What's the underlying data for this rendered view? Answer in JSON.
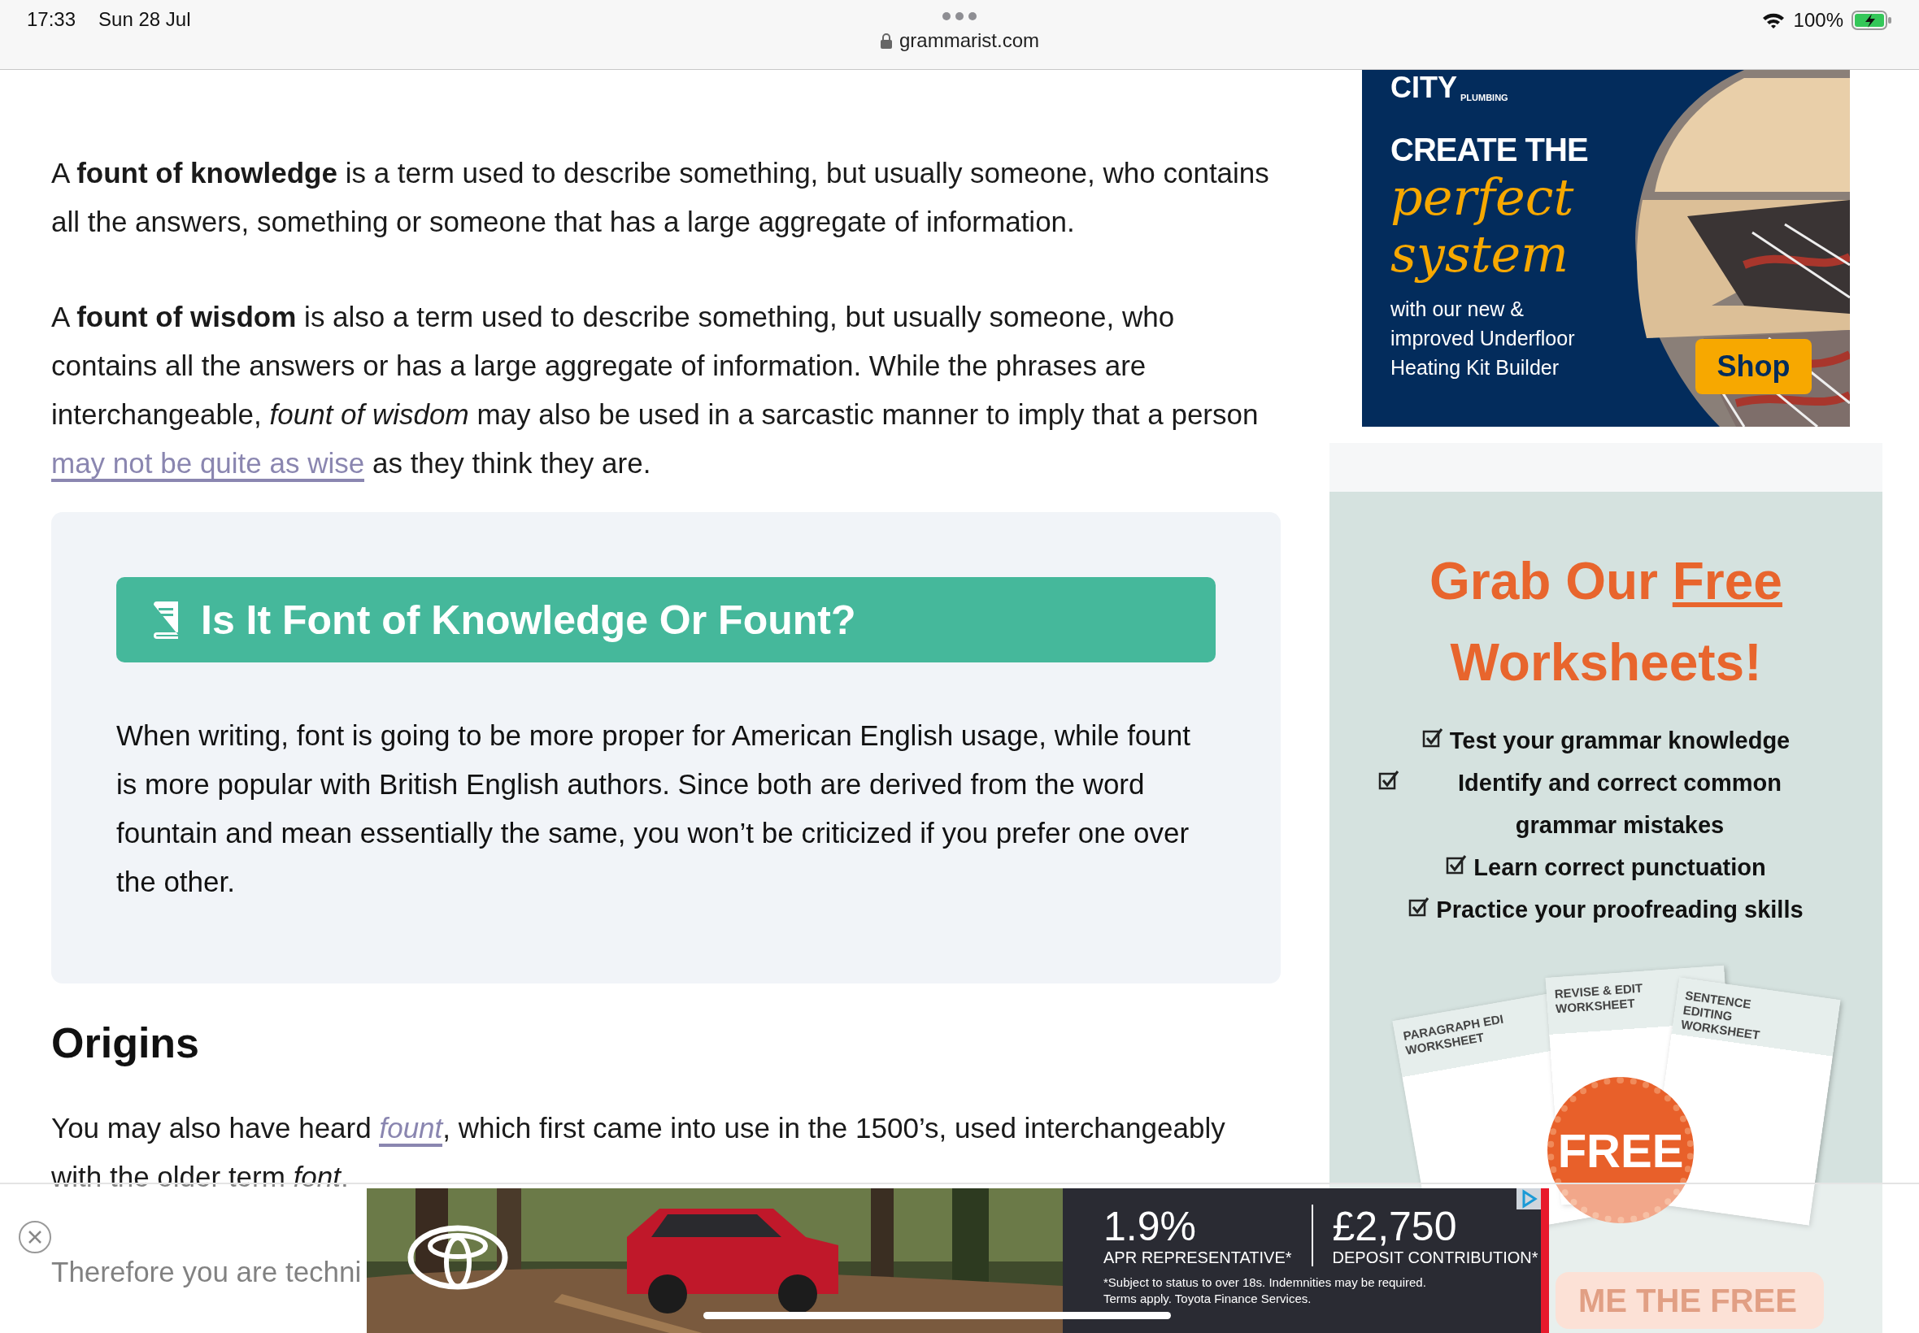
{
  "status_bar": {
    "time": "17:33",
    "date": "Sun 28 Jul",
    "url": "grammarist.com",
    "battery": "100%"
  },
  "article": {
    "paragraphs": [
      {
        "text": "A **fount of knowledge** is a term used to describe something, but usually someone, who contains all the answers, something or someone that has a large aggregate of information."
      },
      {
        "text": "A **fount of wisdom** is also a term used to describe something, but usually someone, who contains all the answers or has a large aggregate of information. While the phrases are interchangeable, *fount of wisdom* may also be used in a sarcastic manner to imply that a person ",
        "link": "may not be quite as wise",
        "after": " as they think they are."
      }
    ],
    "callout": {
      "heading": "Is It Font of Knowledge Or Fount?",
      "text": "When writing, font is going to be more proper for American English usage, while fount is more popular with British English authors. Since both are derived from the word fountain and mean essentially the same, you won’t be criticized if you prefer one over the other."
    },
    "section": {
      "heading": "Origins",
      "paragraphs": [
        {
          "text": "You may also have heard ",
          "link": "fount",
          "link_italic": true,
          "after": ", which first came into use in the 1500’s, used interchangeably with the older term *font*."
        },
        {
          "text": "Therefore you are techni"
        }
      ]
    }
  },
  "sidebar": {
    "ad": {
      "brand": "CITY",
      "brand_sub": "PLUMBING",
      "headline": "CREATE THE",
      "script": [
        "perfect",
        "system"
      ],
      "body": [
        "with our new &",
        "improved Underfloor",
        "Heating Kit Builder"
      ],
      "button": "Shop"
    },
    "worksheet_ad": {
      "title_start": "Grab Our",
      "title_link": "Free",
      "title_end": "Worksheets!",
      "points": [
        {
          "text": "Test your grammar knowledge",
          "checked": true
        },
        {
          "text": "Identify and correct common grammar mistakes",
          "checked": true
        },
        {
          "text": "Learn correct punctuation",
          "checked": true
        },
        {
          "text": "Practice your proofreading skills",
          "checked": true
        }
      ],
      "sheets": [
        "PARAGRAPH EDI WORKSHEET",
        "REVISE & EDIT WORKSHEET",
        "SENTENCE EDITING WORKSHEET"
      ],
      "badge": "FREE",
      "button": "ME THE FREE"
    }
  },
  "bottom_ad": {
    "rate": "1.9%",
    "rate_label": "APR REPRESENTATIVE*",
    "deposit": "£2,750",
    "deposit_label": "DEPOSIT CONTRIBUTION*",
    "terms": [
      "*Subject to status to over 18s. Indemnities may be required.",
      "Terms apply. Toyota Finance Services."
    ]
  }
}
